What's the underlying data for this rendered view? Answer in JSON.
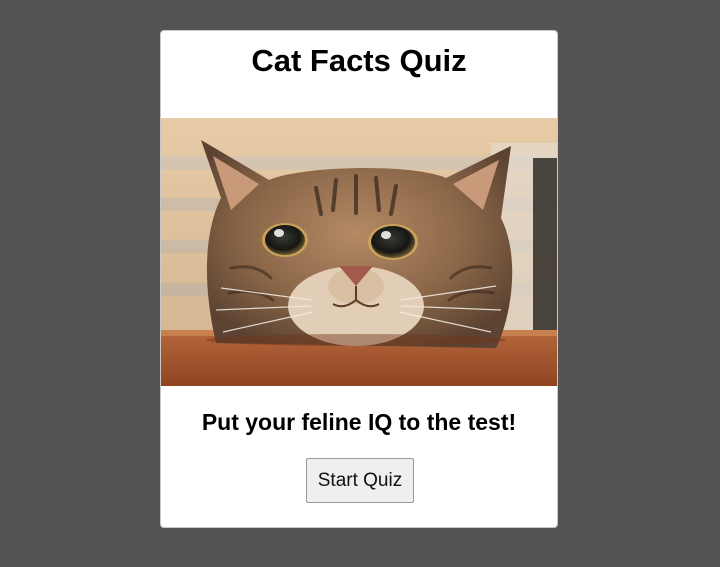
{
  "quiz": {
    "title": "Cat Facts Quiz",
    "tagline": "Put your feline IQ to the test!",
    "start_button_label": "Start Quiz"
  },
  "colors": {
    "page_background": "#545454",
    "card_background": "#ffffff",
    "button_background": "#efefef"
  },
  "image": {
    "subject": "tabby-cat-peeking-over-table"
  }
}
